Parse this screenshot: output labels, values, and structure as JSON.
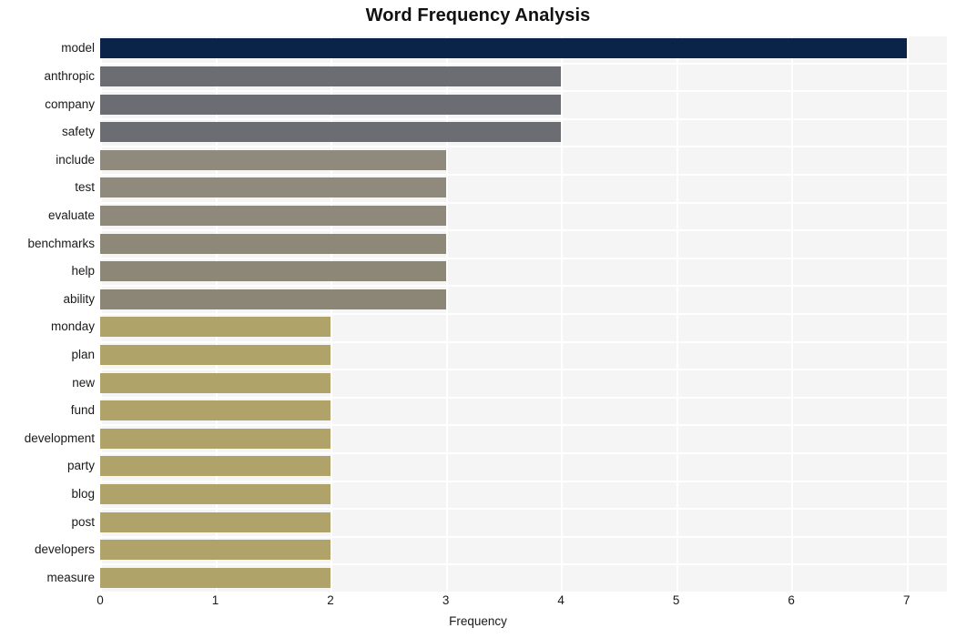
{
  "chart_data": {
    "type": "bar",
    "orientation": "horizontal",
    "title": "Word Frequency Analysis",
    "xlabel": "Frequency",
    "ylabel": "",
    "xlim": [
      0,
      7.35
    ],
    "xticks": [
      0,
      1,
      2,
      3,
      4,
      5,
      6,
      7
    ],
    "xtick_labels": [
      "0",
      "1",
      "2",
      "3",
      "4",
      "5",
      "6",
      "7"
    ],
    "grid": true,
    "legend": "none",
    "categories": [
      "model",
      "anthropic",
      "company",
      "safety",
      "include",
      "test",
      "evaluate",
      "benchmarks",
      "help",
      "ability",
      "monday",
      "plan",
      "new",
      "fund",
      "development",
      "party",
      "blog",
      "post",
      "developers",
      "measure"
    ],
    "values": [
      7,
      4,
      4,
      4,
      3,
      3,
      3,
      3,
      3,
      3,
      2,
      2,
      2,
      2,
      2,
      2,
      2,
      2,
      2,
      2
    ],
    "bar_colors": [
      "#0a2348",
      "#6b6d72",
      "#6b6d72",
      "#6b6d72",
      "#8f8a7b",
      "#8f8a7b",
      "#8e897a",
      "#8d8878",
      "#8c8777",
      "#8b8675",
      "#b0a369",
      "#b0a369",
      "#b0a369",
      "#b0a369",
      "#b0a369",
      "#b0a369",
      "#b0a369",
      "#b0a369",
      "#b0a369",
      "#b0a369"
    ]
  },
  "style": {
    "plot_background": "#f5f5f6",
    "gridline_color": "#ffffff",
    "figure_background": "#ffffff",
    "text_color": "#1a1a1a"
  }
}
